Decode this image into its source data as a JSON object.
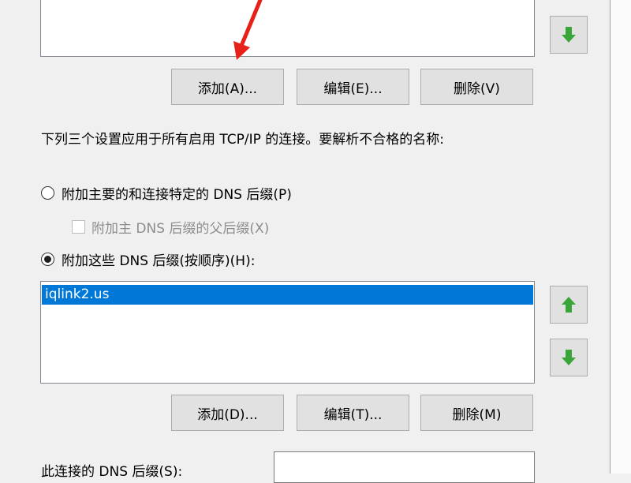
{
  "top_list": {
    "buttons": {
      "add_label": "添加(A)...",
      "edit_label": "编辑(E)...",
      "delete_label": "删除(V)"
    }
  },
  "description": "下列三个设置应用于所有启用 TCP/IP 的连接。要解析不合格的名称:",
  "options": {
    "radio_primary_label": "附加主要的和连接特定的 DNS 后缀(P)",
    "checkbox_parent_label": "附加主 DNS 后缀的父后缀(X)",
    "radio_these_label": "附加这些 DNS 后缀(按顺序)(H):"
  },
  "suffix_list": {
    "items": [
      "iqlink2.us"
    ],
    "buttons": {
      "add_label": "添加(D)...",
      "edit_label": "编辑(T)...",
      "delete_label": "删除(M)"
    }
  },
  "connection_suffix": {
    "label": "此连接的 DNS 后缀(S):",
    "value": ""
  },
  "colors": {
    "selection": "#0078d7",
    "arrow_green": "#3aa63a",
    "annotation_red": "#e8201a"
  },
  "icons": [
    "arrow-up-icon",
    "arrow-down-icon",
    "annotation-arrow"
  ]
}
